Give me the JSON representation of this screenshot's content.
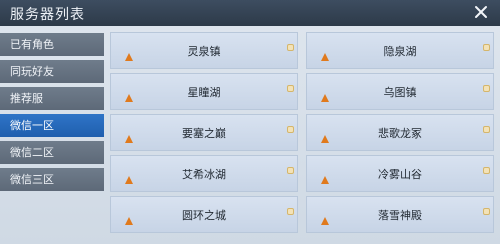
{
  "header": {
    "title": "服务器列表",
    "close_icon": "close-icon"
  },
  "sidebar": {
    "tabs": [
      {
        "label": "已有角色",
        "active": false
      },
      {
        "label": "同玩好友",
        "active": false
      },
      {
        "label": "推荐服",
        "active": false
      },
      {
        "label": "微信一区",
        "active": true
      },
      {
        "label": "微信二区",
        "active": false
      },
      {
        "label": "微信三区",
        "active": false
      }
    ]
  },
  "servers": [
    {
      "name": "灵泉镇",
      "status_icon": "status-orange-triangle-icon",
      "corner_icon": "corner-badge-icon"
    },
    {
      "name": "隐泉湖",
      "status_icon": "status-orange-triangle-icon",
      "corner_icon": "corner-badge-icon"
    },
    {
      "name": "星瞳湖",
      "status_icon": "status-orange-triangle-icon",
      "corner_icon": "corner-badge-icon"
    },
    {
      "name": "乌图镇",
      "status_icon": "status-orange-triangle-icon",
      "corner_icon": "corner-badge-icon"
    },
    {
      "name": "要塞之巅",
      "status_icon": "status-orange-triangle-icon",
      "corner_icon": "corner-badge-icon"
    },
    {
      "name": "悲歌龙冢",
      "status_icon": "status-orange-triangle-icon",
      "corner_icon": "corner-badge-icon"
    },
    {
      "name": "艾希冰湖",
      "status_icon": "status-orange-triangle-icon",
      "corner_icon": "corner-badge-icon"
    },
    {
      "name": "冷雾山谷",
      "status_icon": "status-orange-triangle-icon",
      "corner_icon": "corner-badge-icon"
    },
    {
      "name": "圆环之城",
      "status_icon": "status-orange-triangle-icon",
      "corner_icon": "corner-badge-icon"
    },
    {
      "name": "落雪神殿",
      "status_icon": "status-orange-triangle-icon",
      "corner_icon": "corner-badge-icon"
    }
  ],
  "colors": {
    "titlebar": "#2d3a49",
    "tab_inactive": "#5d6978",
    "tab_active": "#1f5fae",
    "server_tile": "#c7d4e6",
    "status_orange": "#e07a1d"
  }
}
